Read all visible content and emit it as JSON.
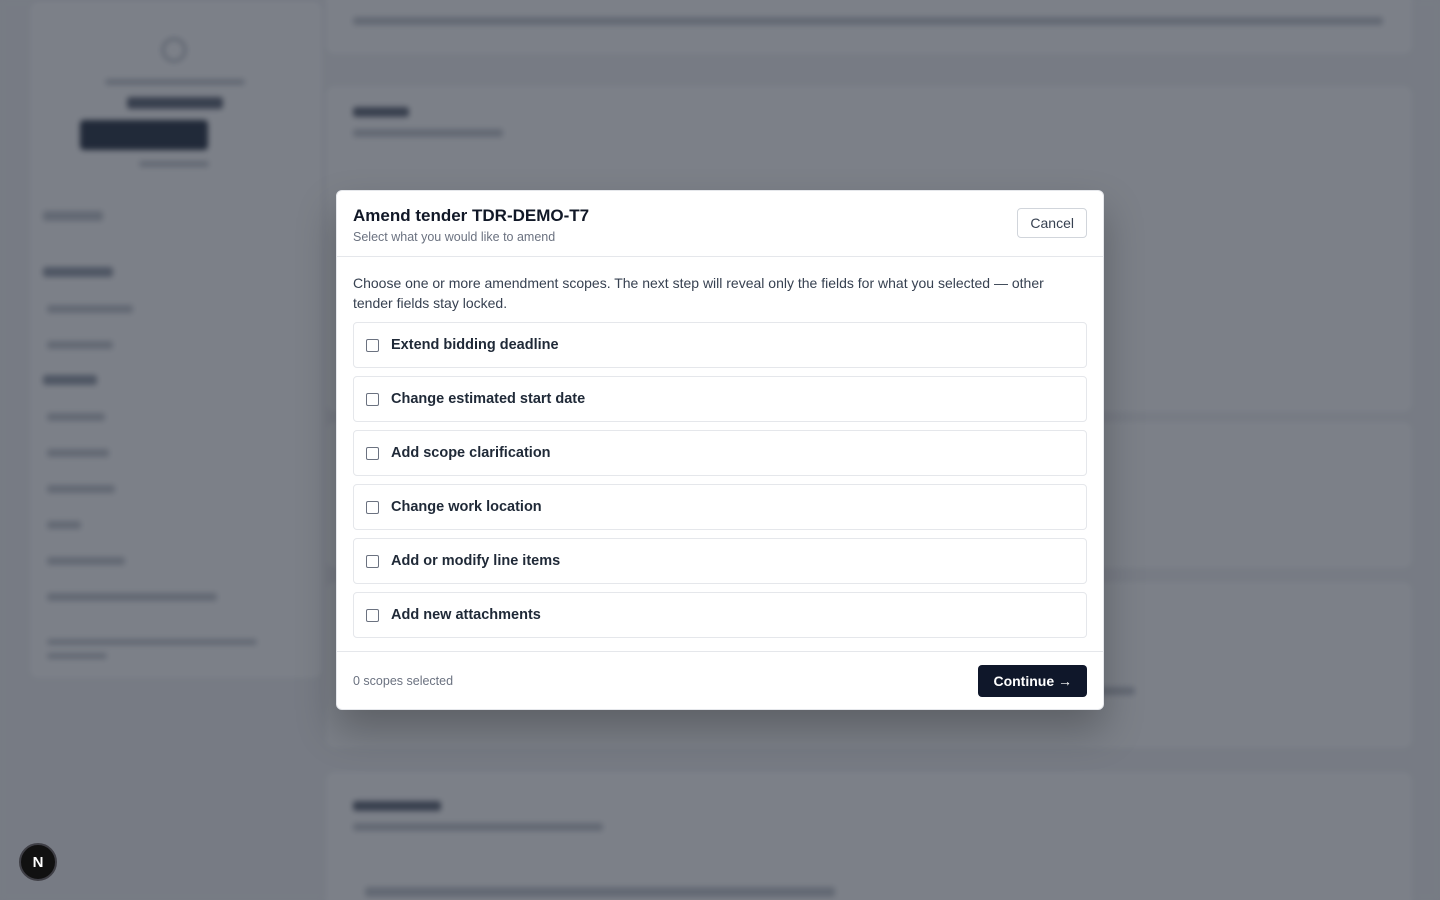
{
  "modal": {
    "title": "Amend tender TDR-DEMO-T7",
    "subtitle": "Select what you would like to amend",
    "cancel_label": "Cancel",
    "intro": "Choose one or more amendment scopes. The next step will reveal only the fields for what you selected — other tender fields stay locked.",
    "scopes": [
      {
        "label": "Extend bidding deadline",
        "checked": false
      },
      {
        "label": "Change estimated start date",
        "checked": false
      },
      {
        "label": "Add scope clarification",
        "checked": false
      },
      {
        "label": "Change work location",
        "checked": false
      },
      {
        "label": "Add or modify line items",
        "checked": false
      },
      {
        "label": "Add new attachments",
        "checked": false
      }
    ],
    "selected_count": "0 scopes selected",
    "continue_label": "Continue →"
  },
  "dev_badge": {
    "letter": "N"
  },
  "colors": {
    "overlay": "#111827",
    "primary_button": "#0f172a",
    "border": "#e5e7eb"
  }
}
